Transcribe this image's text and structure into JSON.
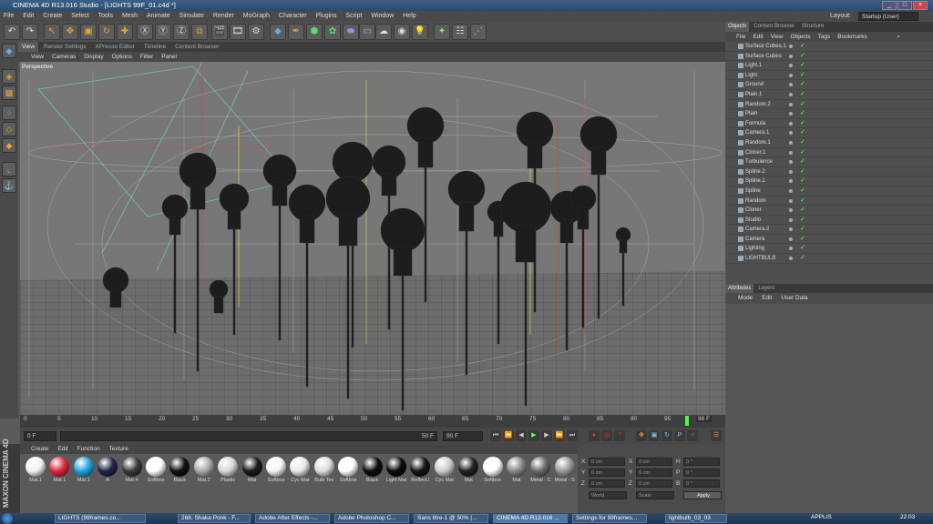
{
  "window_title": "CINEMA 4D R13.016 Studio - [LIGHTS 99F_01.c4d *]",
  "menu": [
    "File",
    "Edit",
    "Create",
    "Select",
    "Tools",
    "Mesh",
    "Animate",
    "Simulate",
    "Render",
    "MoGraph",
    "Character",
    "Plugins",
    "Script",
    "Window",
    "Help"
  ],
  "layout_label": "Layout:",
  "layout_value": "Startup (User)",
  "viewport_tabs": [
    "View",
    "Render Settings",
    "XPresso Editor",
    "Timeline",
    "Content Browser"
  ],
  "viewport_menu": [
    "View",
    "Cameras",
    "Display",
    "Options",
    "Filter",
    "Panel"
  ],
  "viewport_label": "Perspective",
  "timeline_ticks": [
    "0",
    "5",
    "10",
    "15",
    "20",
    "25",
    "30",
    "35",
    "40",
    "45",
    "50",
    "55",
    "60",
    "65",
    "70",
    "75",
    "80",
    "85",
    "90",
    "95"
  ],
  "timeline_end": "98 F",
  "frame_start": "0 F",
  "frame_field": "50 F",
  "frame_end": "90 F",
  "object_tabs": [
    "Objects",
    "Content Browser",
    "Structure"
  ],
  "object_menu": [
    "File",
    "Edit",
    "View",
    "Objects",
    "Tags",
    "Bookmarks"
  ],
  "objects": [
    "Surface Cubes.1",
    "Surface Cubes",
    "Light.1",
    "Light",
    "Ground",
    "Plain.1",
    "Random.2",
    "Plain",
    "Formula",
    "Camera.1",
    "Random.1",
    "Cloner.1",
    "Turbulence",
    "Spline.2",
    "Spline.1",
    "Spline",
    "Random",
    "Cloner",
    "Studio",
    "Camera.2",
    "Camera",
    "Lighting",
    "LIGHTBULB"
  ],
  "attr_tabs": [
    "Attributes",
    "Layers"
  ],
  "attr_menu": [
    "Mode",
    "Edit",
    "User Data"
  ],
  "material_menu": [
    "Create",
    "Edit",
    "Function",
    "Texture"
  ],
  "materials": [
    {
      "label": "Mat.1",
      "color": "#f2f2f2"
    },
    {
      "label": "Mat.1",
      "color": "#e0283a"
    },
    {
      "label": "Mat.1",
      "color": "#20a6e0"
    },
    {
      "label": "A",
      "color": "#20264a"
    },
    {
      "label": "Mat.4",
      "color": "#3a3a3a"
    },
    {
      "label": "Softbox",
      "color": "#ffffff"
    },
    {
      "label": "Black",
      "color": "#111111"
    },
    {
      "label": "Mat.2",
      "color": "#aaaaaa"
    },
    {
      "label": "Plastic",
      "color": "#d8d8d8"
    },
    {
      "label": "Mat",
      "color": "#1a1a1a"
    },
    {
      "label": "Softbox",
      "color": "#f5f5f5"
    },
    {
      "label": "Cyc Mat",
      "color": "#e8e8e8"
    },
    {
      "label": "Bulb Tex",
      "color": "#dddddd"
    },
    {
      "label": "Softbox",
      "color": "#ffffff"
    },
    {
      "label": "Black",
      "color": "#0e0e0e"
    },
    {
      "label": "Light Mat",
      "color": "#0b0b0b"
    },
    {
      "label": "Reflect.I",
      "color": "#151515"
    },
    {
      "label": "Cyc Mat",
      "color": "#cccccc"
    },
    {
      "label": "Mat",
      "color": "#222222"
    },
    {
      "label": "Softbox",
      "color": "#ffffff"
    },
    {
      "label": "Mat",
      "color": "#888888"
    },
    {
      "label": "Metal - C",
      "color": "#6a6a6a"
    },
    {
      "label": "Metal - S",
      "color": "#9a9a9a"
    }
  ],
  "coords": {
    "rows": [
      {
        "a": "X",
        "av": "0 cm",
        "b": "X",
        "bv": "0 cm",
        "c": "H",
        "cv": "0 °"
      },
      {
        "a": "Y",
        "av": "0 cm",
        "b": "Y",
        "bv": "0 cm",
        "c": "P",
        "cv": "0 °"
      },
      {
        "a": "Z",
        "av": "0 cm",
        "b": "Z",
        "bv": "0 cm",
        "c": "B",
        "cv": "0 °"
      }
    ],
    "world": "World",
    "scale": "Scale",
    "apply": "Apply"
  },
  "taskbar": {
    "tasks": [
      "LIGHTS (99frames.co...",
      "268. Shaka Ponk - F...",
      "Adobe After Effects -...",
      "Adobe Photoshop C...",
      "Sans titre-1 @ 50% (...",
      "CINEMA 4D R13.016 ...",
      "Settings for 99frames...",
      "lightbulb_03_03"
    ],
    "lang": "APPLIS",
    "clock": "22:03"
  }
}
